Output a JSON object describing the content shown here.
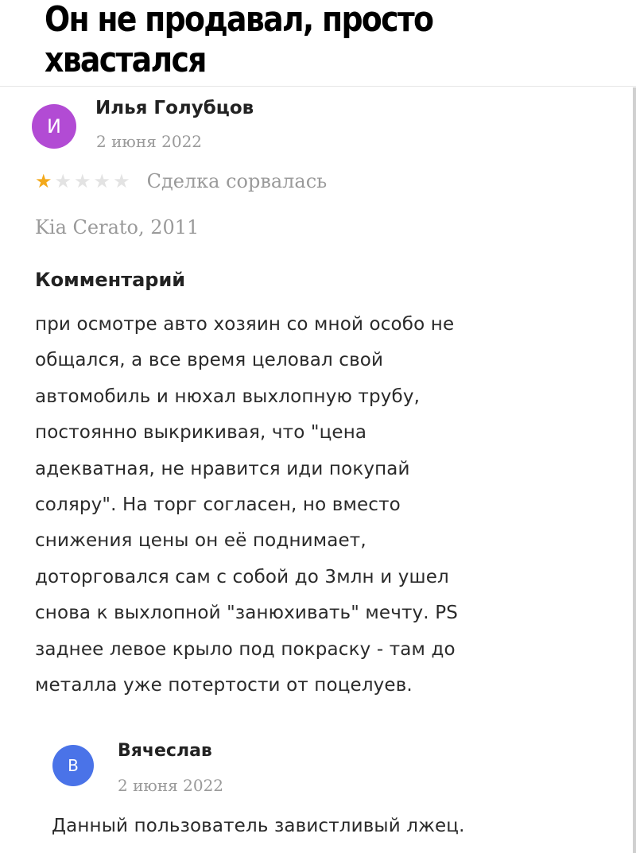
{
  "meme": {
    "title": "Он не продавал, просто хвастался"
  },
  "review": {
    "avatar_letter": "И",
    "avatar_color": "#b24bd4",
    "author": "Илья Голубцов",
    "date": "2 июня 2022",
    "rating": 1,
    "rating_max": 5,
    "star_icon": "star-icon",
    "star_color": "#f3a91b",
    "deal_status": "Сделка сорвалась",
    "car": "Kia Cerato, 2011",
    "comment_heading": "Комментарий",
    "comment_text": "при осмотре авто хозяин со мной особо не\nобщался, а все время целовал свой\nавтомобиль и нюхал выхлопную трубу,\nпостоянно выкрикивая, что \"цена\nадекватная, не нравится иди покупай\nсоляру\". На торг согласен, но вместо\nснижения цены он её поднимает,\nдоторговался сам с собой до 3млн и ушел\nснова к  выхлопной \"занюхивать\" мечту. PS\nзаднее левое крыло под покраску - там до\nметалла уже потертости от поцелуев."
  },
  "reply": {
    "avatar_letter": "В",
    "avatar_color": "#4a73e8",
    "author": "Вячеслав",
    "date": "2 июня 2022",
    "text": "Данный пользователь завистливый лжец."
  }
}
